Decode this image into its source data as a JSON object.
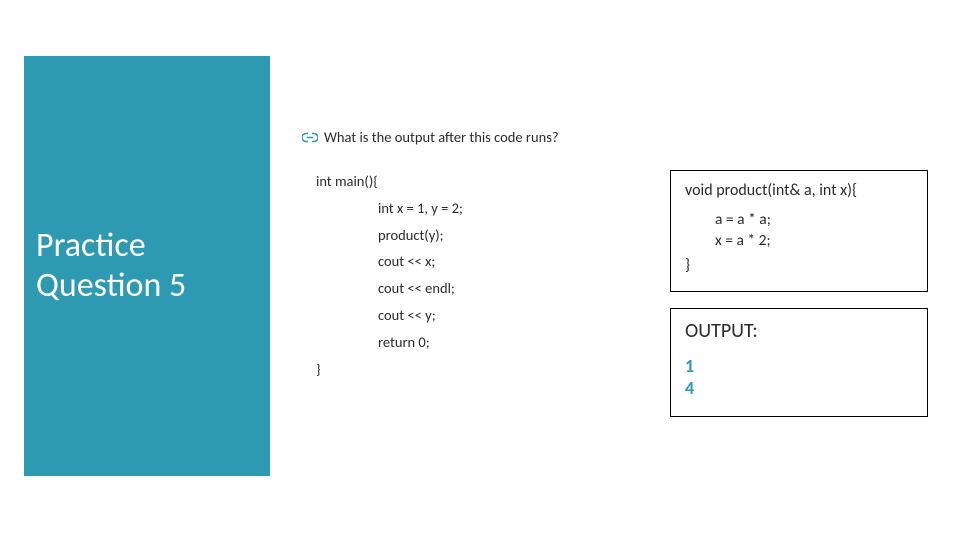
{
  "sidebar": {
    "title_line1": "Practice",
    "title_line2": "Question 5"
  },
  "question": "What is the output after this code runs?",
  "main_code": {
    "l0": "int main(){",
    "l1": "int x = 1, y = 2;",
    "l2": "product(y);",
    "l3": "cout << x;",
    "l4": "cout << endl;",
    "l5": "cout << y;",
    "l6": "return 0;",
    "l7": "}"
  },
  "func_box": {
    "head": "void product(int& a, int x){",
    "b1": "a = a * a;",
    "b2": "x = a * 2;",
    "close": "}"
  },
  "output_box": {
    "label": "OUTPUT:",
    "line1": "1",
    "line2": "4"
  }
}
